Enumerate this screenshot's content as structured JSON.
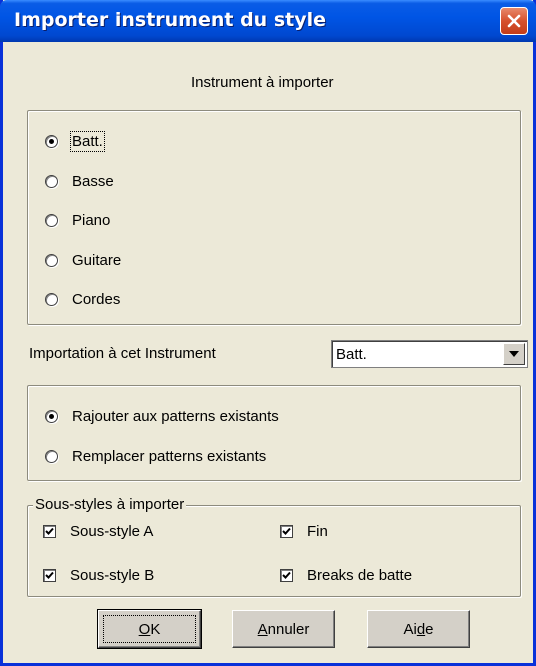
{
  "window": {
    "title": "Importer instrument du style"
  },
  "instrument_section": {
    "heading": "Instrument à importer",
    "options": [
      {
        "label": "Batt.",
        "checked": true
      },
      {
        "label": "Basse",
        "checked": false
      },
      {
        "label": "Piano",
        "checked": false
      },
      {
        "label": "Guitare",
        "checked": false
      },
      {
        "label": "Cordes",
        "checked": false
      }
    ]
  },
  "target_instrument": {
    "label": "Importation à cet Instrument",
    "selected": "Batt."
  },
  "mode_section": {
    "options": [
      {
        "label": "Rajouter aux patterns existants",
        "checked": true
      },
      {
        "label": "Remplacer patterns existants",
        "checked": false
      }
    ]
  },
  "substyles_section": {
    "legend": "Sous-styles à importer",
    "checkboxes": [
      {
        "label": "Sous-style A",
        "checked": true
      },
      {
        "label": "Fin",
        "checked": true
      },
      {
        "label": "Sous-style B",
        "checked": true
      },
      {
        "label": "Breaks de batte",
        "checked": true
      }
    ]
  },
  "buttons": {
    "ok": {
      "mnemonic": "O",
      "rest": "K"
    },
    "cancel": {
      "mnemonic": "A",
      "rest": "nnuler"
    },
    "help": {
      "pre": "Ai",
      "mnemonic": "d",
      "rest": "e"
    }
  },
  "icons": {
    "close": "close-icon",
    "dropdown": "chevron-down-icon",
    "check": "check-icon"
  },
  "colors": {
    "titlebar": "#0055e5",
    "dialog_bg": "#ece9d8",
    "close_button": "#d6512d"
  }
}
